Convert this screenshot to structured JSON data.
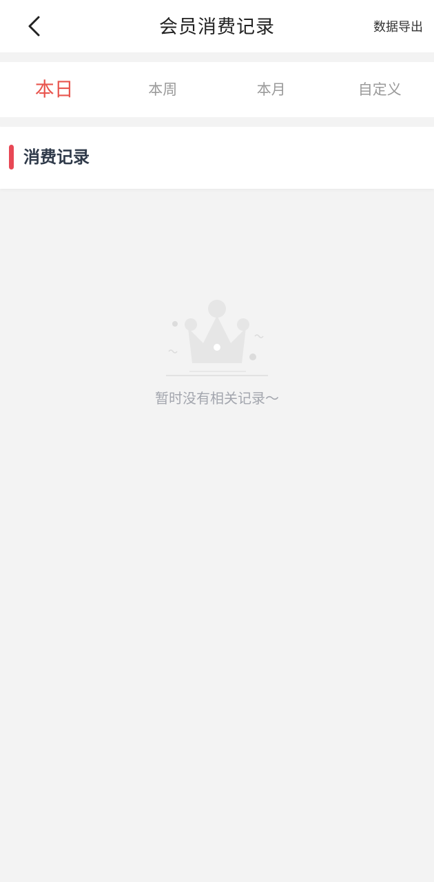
{
  "header": {
    "title": "会员消费记录",
    "export_label": "数据导出"
  },
  "tabs": [
    {
      "label": "本日",
      "active": true
    },
    {
      "label": "本周",
      "active": false
    },
    {
      "label": "本月",
      "active": false
    },
    {
      "label": "自定义",
      "active": false
    }
  ],
  "section": {
    "title": "消费记录"
  },
  "empty_state": {
    "message": "暂时没有相关记录～",
    "icon": "crown-icon"
  },
  "colors": {
    "accent": "#e8554e",
    "section_bar": "#e84855",
    "background": "#f3f3f3"
  }
}
